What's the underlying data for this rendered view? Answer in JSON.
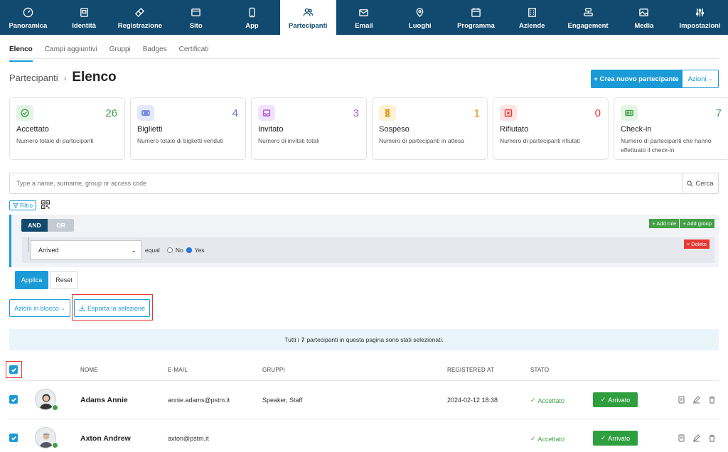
{
  "nav": [
    {
      "label": "Panoramica",
      "icon": "gauge-icon"
    },
    {
      "label": "Identità",
      "icon": "id-badge-icon"
    },
    {
      "label": "Registrazione",
      "icon": "ticket-icon"
    },
    {
      "label": "Sito",
      "icon": "browser-icon"
    },
    {
      "label": "App",
      "icon": "phone-icon"
    },
    {
      "label": "Partecipanti",
      "icon": "users-icon",
      "active": true
    },
    {
      "label": "Email",
      "icon": "mail-icon"
    },
    {
      "label": "Luoghi",
      "icon": "map-pin-icon"
    },
    {
      "label": "Programma",
      "icon": "calendar-icon"
    },
    {
      "label": "Aziende",
      "icon": "building-icon"
    },
    {
      "label": "Engagement",
      "icon": "engagement-icon"
    },
    {
      "label": "Media",
      "icon": "image-icon"
    },
    {
      "label": "Impostazioni",
      "icon": "sliders-icon"
    }
  ],
  "subtabs": [
    "Elenco",
    "Campi aggiuntivi",
    "Gruppi",
    "Badges",
    "Certificati"
  ],
  "header": {
    "breadcrumb_parent": "Partecipanti",
    "breadcrumb_sep": "›",
    "title": "Elenco",
    "create_label": "+ Crea nuovo partecipante",
    "actions_label": "Azioni"
  },
  "cards": [
    {
      "value": "26",
      "label": "Accettato",
      "desc": "Numero totale di partecipanti",
      "color": "#43a047",
      "bg": "#e3f4e4",
      "icon": "check-circle-icon"
    },
    {
      "value": "4",
      "label": "Biglietti",
      "desc": "Numero totale di biglietti venduti",
      "color": "#5b6fd6",
      "bg": "#e3e8fb",
      "icon": "ticket-icon"
    },
    {
      "value": "3",
      "label": "Invitato",
      "desc": "Numero di invitati totali",
      "color": "#b05bd6",
      "bg": "#f1e3fb",
      "icon": "inbox-icon"
    },
    {
      "value": "1",
      "label": "Sospeso",
      "desc": "Numero di partecipanti in attesa",
      "color": "#e08a00",
      "bg": "#fdf1d6",
      "icon": "hourglass-icon"
    },
    {
      "value": "0",
      "label": "Rifiutato",
      "desc": "Numero di partecipanti rifiutati",
      "color": "#e53935",
      "bg": "#fde3e3",
      "icon": "x-square-icon"
    },
    {
      "value": "7",
      "label": "Check-in",
      "desc": "Numero di partecipanti che hanno effettuato il check-in",
      "color": "#43a047",
      "bg": "#e3f4e4",
      "icon": "id-card-icon"
    }
  ],
  "search": {
    "placeholder": "Type a name, surname, group or access code",
    "button": "Cerca"
  },
  "filter": {
    "filtro_label": "Filtro",
    "and_label": "AND",
    "or_label": "OR",
    "add_rule": "+ Add rule",
    "add_group": "+ Add group",
    "field": "Arrived",
    "operator": "equal",
    "opt_no": "No",
    "opt_yes": "Yes",
    "delete": "× Delete",
    "apply": "Applica",
    "reset": "Reset"
  },
  "bulk": {
    "actions_label": "Azioni in blocco",
    "export_label": "Esporta la selezione"
  },
  "banner": {
    "prefix": "Tutti i",
    "count": "7",
    "suffix": "partecipanti in questa pagina sono stati selezionati."
  },
  "table": {
    "headers": {
      "name": "NOME",
      "email": "E-MAIL",
      "groups": "GRUPPI",
      "registered": "REGISTERED AT",
      "status": "STATO"
    },
    "rows": [
      {
        "name": "Adams Annie",
        "email": "annie.adams@pstm.it",
        "groups": "Speaker, Staff",
        "registered": "2024-02-12 18:38",
        "status": "Accettato",
        "arrived": "Arrivato"
      },
      {
        "name": "Axton Andrew",
        "email": "axton@pstm.it",
        "groups": "",
        "registered": "",
        "status": "Accettato",
        "arrived": "Arrivato"
      }
    ]
  }
}
